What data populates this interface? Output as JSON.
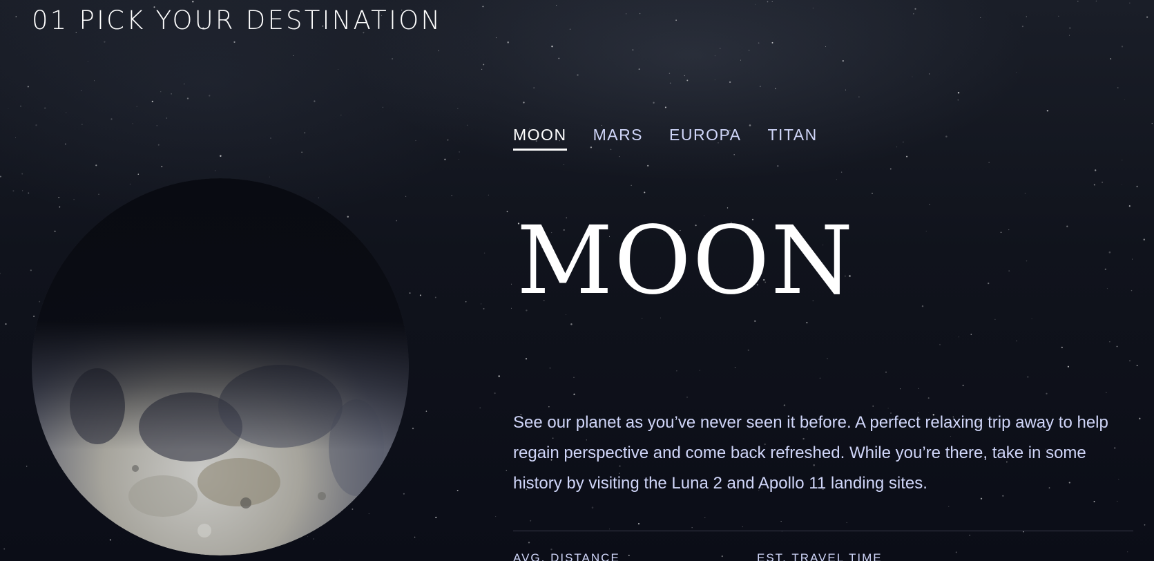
{
  "header": {
    "step_number": "01",
    "title": "PICK YOUR DESTINATION"
  },
  "tabs": [
    {
      "label": "MOON",
      "active": true
    },
    {
      "label": "MARS",
      "active": false
    },
    {
      "label": "EUROPA",
      "active": false
    },
    {
      "label": "TITAN",
      "active": false
    }
  ],
  "destination": {
    "name": "MOON",
    "description": "See our planet as you’ve never seen it before. A perfect relaxing trip away to help regain perspective and come back refreshed. While you’re there, take in some history by visiting the Luna 2 and Apollo 11 landing sites."
  },
  "stats": {
    "distance_label": "AVG. DISTANCE",
    "travel_label": "EST. TRAVEL TIME"
  },
  "colors": {
    "background": "#0b0d17",
    "text": "#ffffff",
    "text_muted": "#d0d6f9",
    "divider": "#383b4b"
  }
}
